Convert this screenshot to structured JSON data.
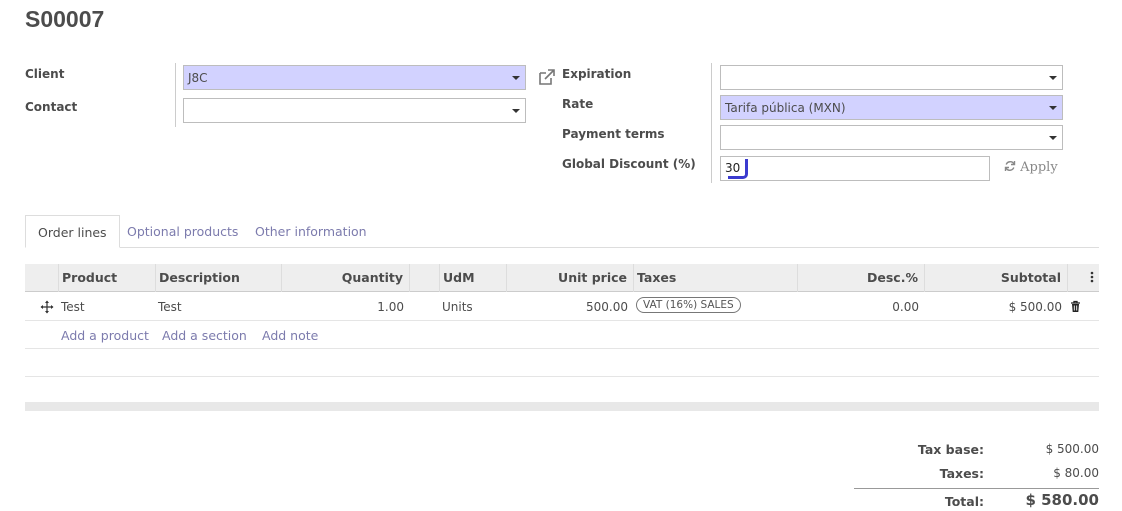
{
  "record": {
    "title": "S00007"
  },
  "left_fields": {
    "client_label": "Client",
    "client_value": "J8C",
    "contact_label": "Contact",
    "contact_value": ""
  },
  "right_fields": {
    "expiration_label": "Expiration",
    "expiration_value": "",
    "rate_label": "Rate",
    "rate_value": "Tarifa pública (MXN)",
    "payment_terms_label": "Payment terms",
    "payment_terms_value": "",
    "discount_label": "Global Discount (%)",
    "discount_value": "30",
    "apply_label": "Apply"
  },
  "tabs": [
    {
      "label": "Order lines",
      "active": true
    },
    {
      "label": "Optional products",
      "active": false
    },
    {
      "label": "Other information",
      "active": false
    }
  ],
  "table": {
    "columns": [
      "Product",
      "Description",
      "Quantity",
      "UdM",
      "Unit price",
      "Taxes",
      "Desc.%",
      "Subtotal"
    ],
    "rows": [
      {
        "product": "Test",
        "description": "Test",
        "quantity": "1.00",
        "udm": "Units",
        "unit_price": "500.00",
        "tax": "VAT (16%) SALES",
        "discount": "0.00",
        "subtotal": "$ 500.00"
      }
    ],
    "actions": {
      "add_product": "Add a product",
      "add_section": "Add a section",
      "add_note": "Add note"
    }
  },
  "totals": {
    "tax_base_label": "Tax base:",
    "tax_base_value": "$ 500.00",
    "taxes_label": "Taxes:",
    "taxes_value": "$ 80.00",
    "total_label": "Total:",
    "total_value": "$ 580.00"
  },
  "colors": {
    "required_field_bg": "#d2d2ff",
    "link": "#7c7bad",
    "cursor": "#3b3bcf"
  },
  "icons": [
    "external-link-icon",
    "refresh-icon",
    "move-handle-icon",
    "trash-icon",
    "column-options-icon",
    "dropdown-caret-icon"
  ]
}
